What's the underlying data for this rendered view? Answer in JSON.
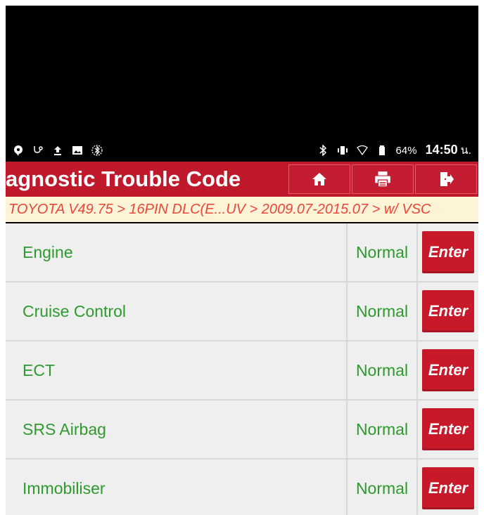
{
  "status_bar": {
    "battery_percent": "64%",
    "time": "14:50",
    "time_suffix": "น."
  },
  "header": {
    "title": "agnostic Trouble Code",
    "buttons": {
      "home": "home-icon",
      "print": "printer-icon",
      "exit": "exit-icon"
    }
  },
  "breadcrumb": "TOYOTA V49.75 > 16PIN DLC(E...UV > 2009.07-2015.07 > w/ VSC",
  "rows": [
    {
      "name": "Engine",
      "status": "Normal",
      "action": "Enter"
    },
    {
      "name": "Cruise Control",
      "status": "Normal",
      "action": "Enter"
    },
    {
      "name": "ECT",
      "status": "Normal",
      "action": "Enter"
    },
    {
      "name": "SRS Airbag",
      "status": "Normal",
      "action": "Enter"
    },
    {
      "name": "Immobiliser",
      "status": "Normal",
      "action": "Enter"
    }
  ],
  "colors": {
    "accent": "#c0192c",
    "text_green": "#2e9a2e",
    "breadcrumb_text": "#e8473a",
    "breadcrumb_bg": "#fdf3d6"
  }
}
